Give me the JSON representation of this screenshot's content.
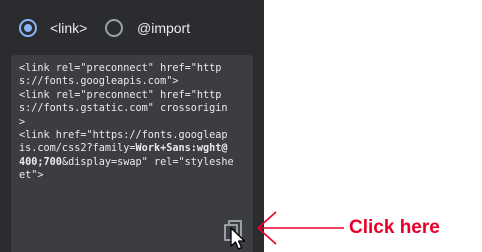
{
  "embed_options": {
    "link_label": "<link>",
    "import_label": "@import",
    "selected": "link"
  },
  "code_snippet": {
    "lines": [
      "<link rel=\"preconnect\" href=\"http",
      "s://fonts.googleapis.com\">",
      "<link rel=\"preconnect\" href=\"http",
      "s://fonts.gstatic.com\" crossorigin",
      ">",
      "<link href=\"https://fonts.googleap",
      "is.com/css2?family=",
      "Work+Sans:wght@",
      "400;700",
      "&display=swap\" rel=\"styleshe",
      "et\">"
    ]
  },
  "copy_button": {
    "icon": "copy-icon"
  },
  "annotation": {
    "text": "Click here",
    "color": "#e8002b"
  },
  "colors": {
    "panel_bg": "#2b2c30",
    "code_bg": "#3c3d41",
    "accent": "#8ab4f8",
    "text": "#e8eaed"
  }
}
